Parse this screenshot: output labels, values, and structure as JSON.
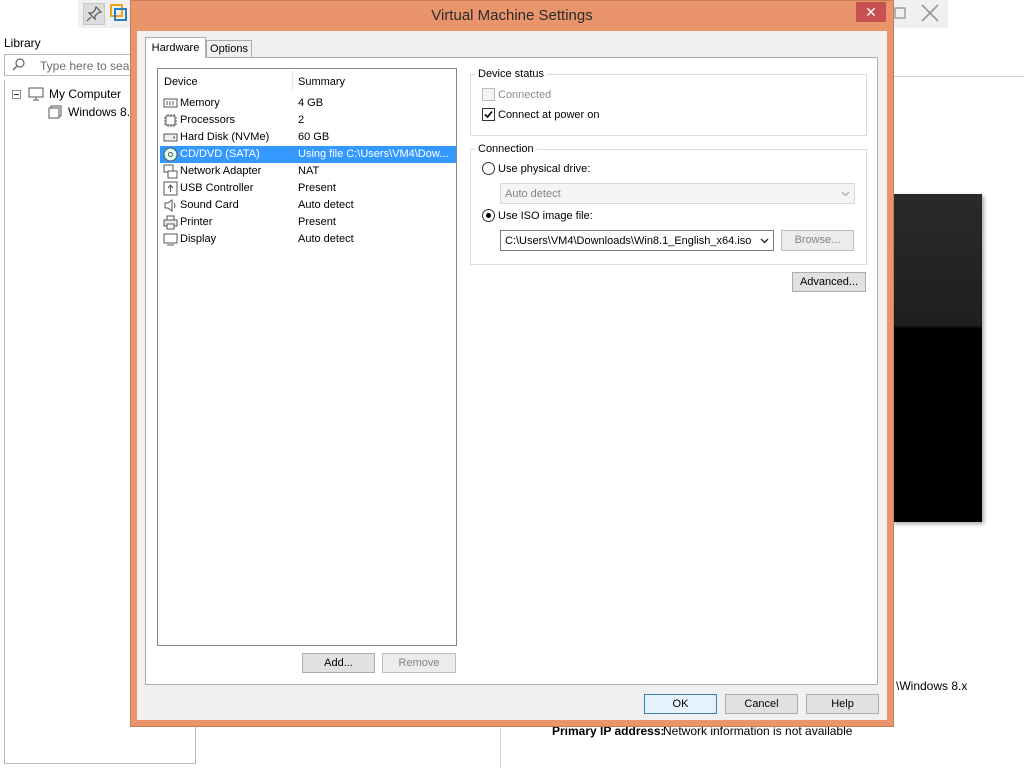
{
  "background": {
    "library_title": "Library",
    "search_placeholder": "Type here to sear",
    "tree_root": "My Computer",
    "tree_child": "Windows 8.",
    "vm_path": "\\Windows 8.x",
    "ip_label": "Primary IP address:",
    "ip_value": "Network information is not available"
  },
  "dialog": {
    "title": "Virtual Machine Settings",
    "close_glyph": "✕",
    "tabs": [
      {
        "label": "Hardware",
        "selected": true
      },
      {
        "label": "Options",
        "selected": false
      }
    ],
    "device_list": {
      "columns": [
        "Device",
        "Summary"
      ],
      "rows": [
        {
          "name": "Memory",
          "summary": "4 GB",
          "icon": "memory-icon"
        },
        {
          "name": "Processors",
          "summary": "2",
          "icon": "processor-icon"
        },
        {
          "name": "Hard Disk (NVMe)",
          "summary": "60 GB",
          "icon": "hard-disk-icon"
        },
        {
          "name": "CD/DVD (SATA)",
          "summary": "Using file C:\\Users\\VM4\\Dow...",
          "icon": "cd-dvd-icon",
          "selected": true
        },
        {
          "name": "Network Adapter",
          "summary": "NAT",
          "icon": "network-adapter-icon"
        },
        {
          "name": "USB Controller",
          "summary": "Present",
          "icon": "usb-icon"
        },
        {
          "name": "Sound Card",
          "summary": "Auto detect",
          "icon": "speaker-icon"
        },
        {
          "name": "Printer",
          "summary": "Present",
          "icon": "printer-icon"
        },
        {
          "name": "Display",
          "summary": "Auto detect",
          "icon": "monitor-icon"
        }
      ]
    },
    "add_button": "Add...",
    "remove_button": "Remove",
    "device_status": {
      "title": "Device status",
      "connected_label": "Connected",
      "connected_checked": false,
      "connected_enabled": false,
      "connect_power_label": "Connect at power on",
      "connect_power_checked": true
    },
    "connection": {
      "title": "Connection",
      "physical_label": "Use physical drive:",
      "physical_value": "Auto detect",
      "iso_label": "Use ISO image file:",
      "iso_value": "C:\\Users\\VM4\\Downloads\\Win8.1_English_x64.iso",
      "browse_button": "Browse...",
      "selected": "iso"
    },
    "advanced_button": "Advanced...",
    "ok_button": "OK",
    "cancel_button": "Cancel",
    "help_button": "Help"
  }
}
